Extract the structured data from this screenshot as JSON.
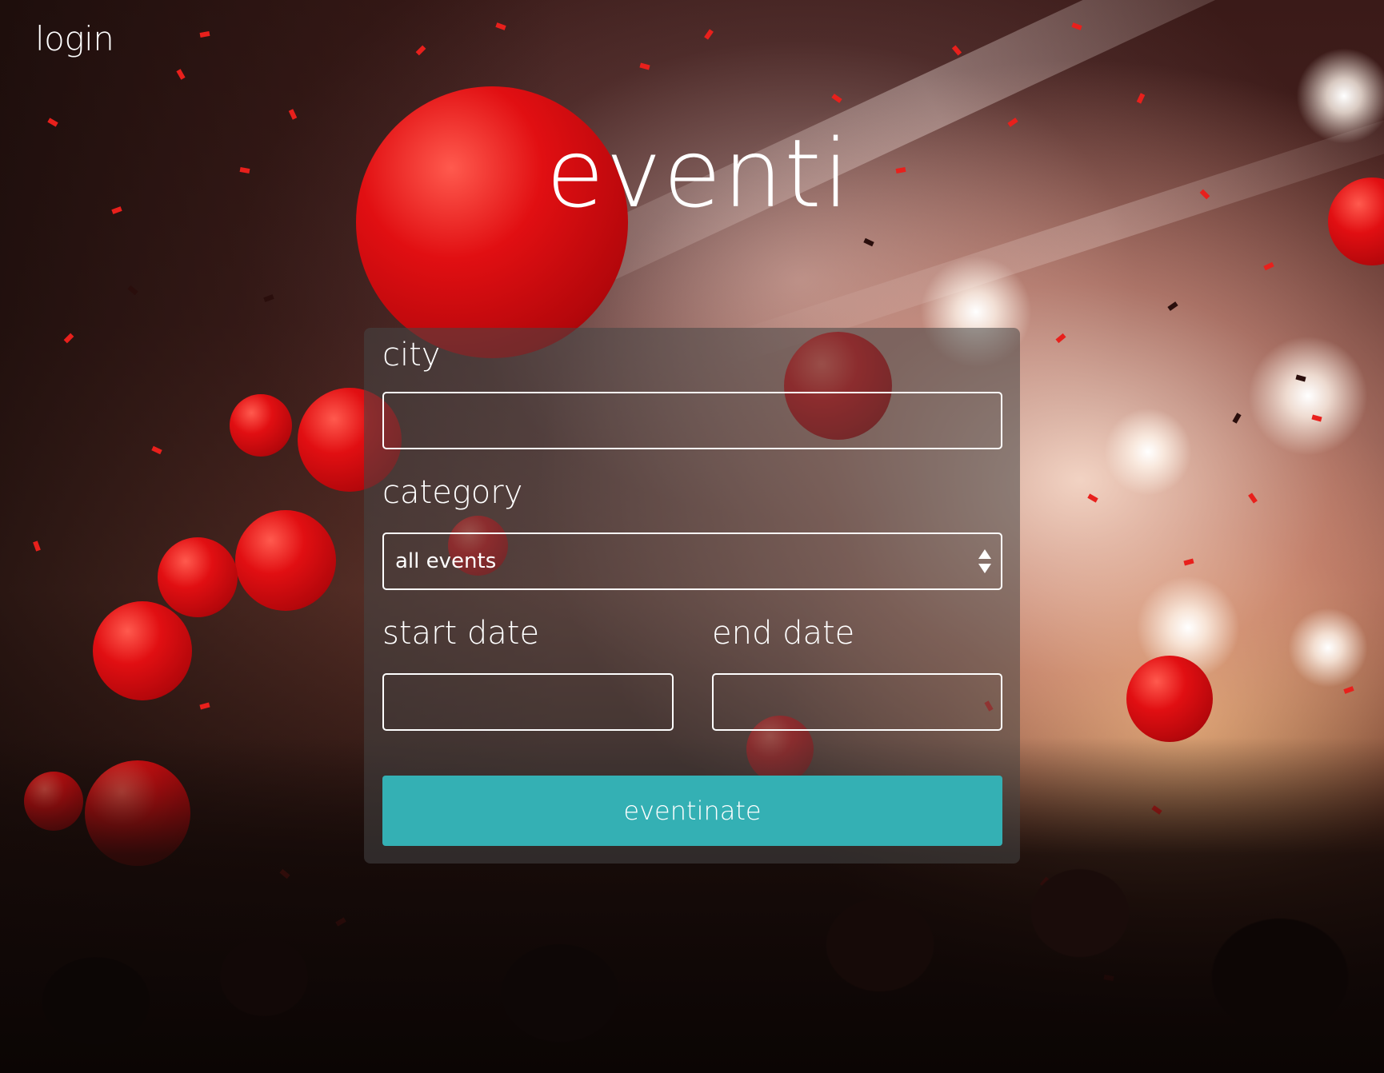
{
  "header": {
    "login_label": "login"
  },
  "brand": {
    "title": "eventi"
  },
  "form": {
    "city": {
      "label": "city",
      "value": "",
      "placeholder": ""
    },
    "category": {
      "label": "category",
      "selected": "all events"
    },
    "start_date": {
      "label": "start date",
      "value": ""
    },
    "end_date": {
      "label": "end date",
      "value": ""
    },
    "submit_label": "eventinate"
  },
  "colors": {
    "accent": "#34b0b4",
    "text": "#ffffff",
    "balloon": "#e10f12"
  },
  "icons": {
    "select": "updown-arrows-icon"
  }
}
